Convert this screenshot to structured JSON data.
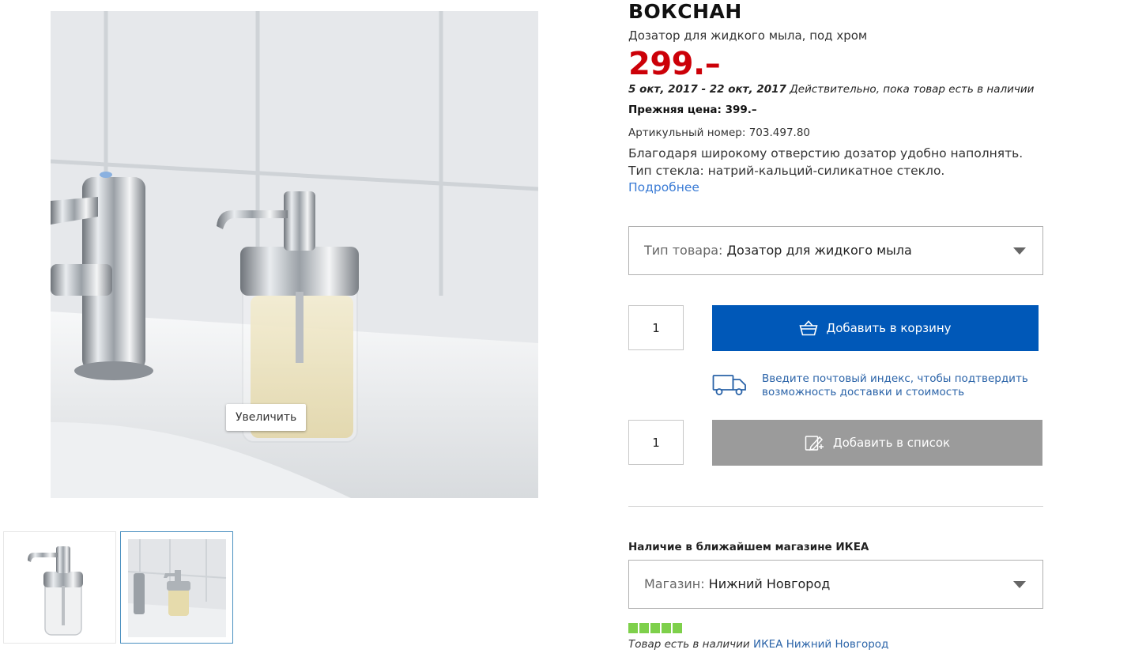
{
  "product": {
    "name": "ВОКСНАН",
    "type": "Дозатор для жидкого мыла, под хром",
    "price": "299.–",
    "validity_dates": "5 окт, 2017 - 22 окт, 2017",
    "validity_note": " Действительно, пока товар есть в наличии",
    "prev_price_label": "Прежняя цена: ",
    "prev_price_value": "399.–",
    "article_label": "Артикульный номер: ",
    "article_number": "703.497.80",
    "desc_line1": "Благодаря широкому отверстию дозатор удобно наполнять.",
    "desc_line2": "Тип стекла: натрий-кальций-силикатное стекло.",
    "more_link": "Подробнее"
  },
  "gallery": {
    "zoom_label": "Увеличить",
    "selected_thumb": 2
  },
  "type_select": {
    "label": "Тип товара:",
    "value": "Дозатор для жидкого мыла"
  },
  "cart": {
    "quantity": "1",
    "button_label": "Добавить в корзину",
    "icon": "basket-icon"
  },
  "delivery": {
    "line1": "Введите почтовый индекс, чтобы подтвердить",
    "line2": "возможность доставки и стоимость",
    "icon": "truck-icon"
  },
  "shopping_list": {
    "quantity": "1",
    "button_label": "Добавить в список",
    "icon": "pencil-list-icon"
  },
  "availability": {
    "title": "Наличие в ближайшем магазине ИКЕА",
    "store_label": "Магазин:",
    "store_value": "Нижний Новгород",
    "stock_level": 1.0,
    "stock_text": "Товар есть в наличии ",
    "stock_store": "ИКЕА Нижний Новгород"
  },
  "colors": {
    "price": "#cc0008",
    "cart_button": "#0058b8",
    "list_button": "#9b9b9b",
    "link": "#3a7bd5",
    "stock": "#7ed04b"
  }
}
